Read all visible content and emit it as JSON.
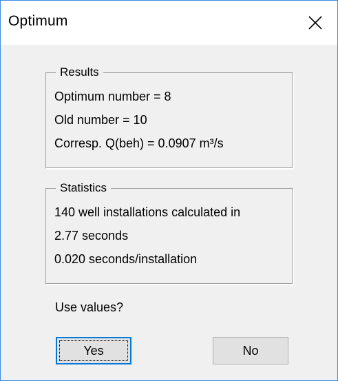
{
  "window": {
    "title": "Optimum"
  },
  "results": {
    "legend": "Results",
    "lines": [
      "Optimum number = 8",
      "Old number = 10",
      "Corresp. Q(beh) = 0.0907 m³/s"
    ]
  },
  "statistics": {
    "legend": "Statistics",
    "lines": [
      "140 well installations calculated in",
      "2.77 seconds",
      "0.020 seconds/installation"
    ]
  },
  "prompt": "Use values?",
  "buttons": {
    "yes_label": "Yes",
    "no_label": "No"
  },
  "icons": {
    "close": "close-icon"
  },
  "colors": {
    "window_border": "#3c8be0",
    "dialog_background": "#f0f0f0",
    "default_button_border": "#0078d7"
  }
}
